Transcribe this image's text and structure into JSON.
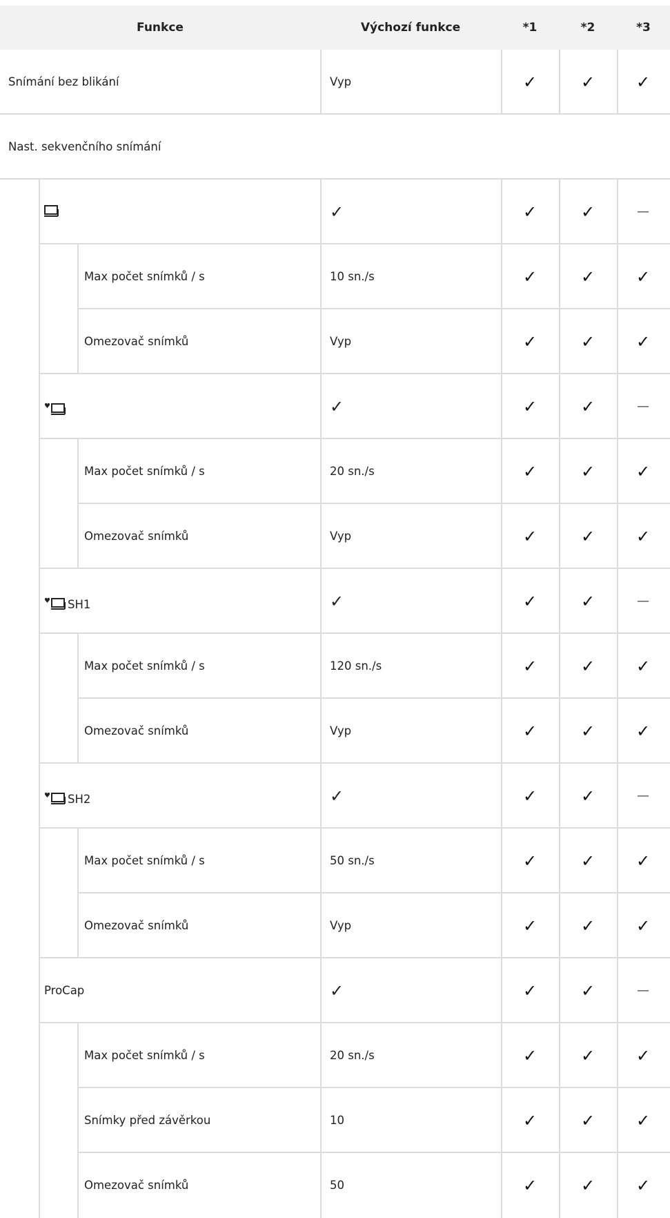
{
  "header": {
    "col_function": "Funkce",
    "col_default": "Výchozí funkce",
    "col_1": "*1",
    "col_2": "*2",
    "col_3": "*3"
  },
  "symbols": {
    "check": "✓",
    "dash": "—",
    "heart": "♥"
  },
  "rows": [
    {
      "label": "Snímání bez blikání",
      "default": "Vyp",
      "c1": true,
      "c2": true,
      "c3": true
    },
    {
      "label": "Nast. sekvenčního snímání"
    },
    {
      "icon": "burst-icon",
      "label": "",
      "default_check": true,
      "c1": true,
      "c2": true,
      "c3": false
    },
    {
      "label": "Max počet snímků / s",
      "default": "10 sn./s",
      "c1": true,
      "c2": true,
      "c3": true
    },
    {
      "label": "Omezovač snímků",
      "default": "Vyp",
      "c1": true,
      "c2": true,
      "c3": true
    },
    {
      "icon": "silent-burst-icon",
      "label": "",
      "default_check": true,
      "c1": true,
      "c2": true,
      "c3": false
    },
    {
      "label": "Max počet snímků / s",
      "default": "20 sn./s",
      "c1": true,
      "c2": true,
      "c3": true
    },
    {
      "label": "Omezovač snímků",
      "default": "Vyp",
      "c1": true,
      "c2": true,
      "c3": true
    },
    {
      "icon": "silent-burst-icon",
      "label": "SH1",
      "default_check": true,
      "c1": true,
      "c2": true,
      "c3": false
    },
    {
      "label": "Max počet snímků / s",
      "default": "120 sn./s",
      "c1": true,
      "c2": true,
      "c3": true
    },
    {
      "label": "Omezovač snímků",
      "default": "Vyp",
      "c1": true,
      "c2": true,
      "c3": true
    },
    {
      "icon": "silent-burst-icon",
      "label": "SH2",
      "default_check": true,
      "c1": true,
      "c2": true,
      "c3": false
    },
    {
      "label": "Max počet snímků / s",
      "default": "50 sn./s",
      "c1": true,
      "c2": true,
      "c3": true
    },
    {
      "label": "Omezovač snímků",
      "default": "Vyp",
      "c1": true,
      "c2": true,
      "c3": true
    },
    {
      "label": "ProCap",
      "default_check": true,
      "c1": true,
      "c2": true,
      "c3": false
    },
    {
      "label": "Max počet snímků / s",
      "default": "20 sn./s",
      "c1": true,
      "c2": true,
      "c3": true
    },
    {
      "label": "Snímky před závěrkou",
      "default": "10",
      "c1": true,
      "c2": true,
      "c3": true
    },
    {
      "label": "Omezovač snímků",
      "default": "50",
      "c1": true,
      "c2": true,
      "c3": true
    }
  ]
}
